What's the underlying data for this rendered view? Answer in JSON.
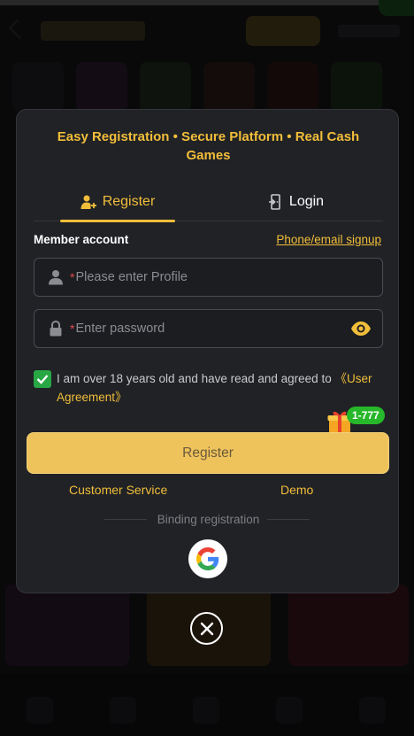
{
  "modal": {
    "tagline": "Easy Registration • Secure Platform • Real Cash Games",
    "tabs": [
      {
        "label": "Register",
        "icon": "add-user-icon",
        "active": true
      },
      {
        "label": "Login",
        "icon": "login-door-icon",
        "active": false
      }
    ],
    "member_account_label": "Member account",
    "phone_email_link": "Phone/email signup",
    "profile_field": {
      "required_mark": "*",
      "placeholder": "Please enter Profile",
      "icon": "user-icon"
    },
    "password_field": {
      "required_mark": "*",
      "placeholder": "Enter password",
      "icon": "lock-icon",
      "toggle_icon": "eye-icon"
    },
    "agreement": {
      "checked": true,
      "text": "I am over 18 years old and have read and agreed to ",
      "link": "《User Agreement》"
    },
    "promo_badge": "1-777",
    "register_button": "Register",
    "customer_service_link": "Customer Service",
    "demo_link": "Demo",
    "binding_label": "Binding registration",
    "social": [
      {
        "name": "Google",
        "icon": "google-icon"
      }
    ]
  },
  "colors": {
    "accent": "#f2be3a",
    "button": "#efc35c",
    "checkbox": "#28a745",
    "badge": "#27b72a",
    "modal_bg": "#202226",
    "required": "#e34b4b"
  },
  "close_icon": "close-icon"
}
